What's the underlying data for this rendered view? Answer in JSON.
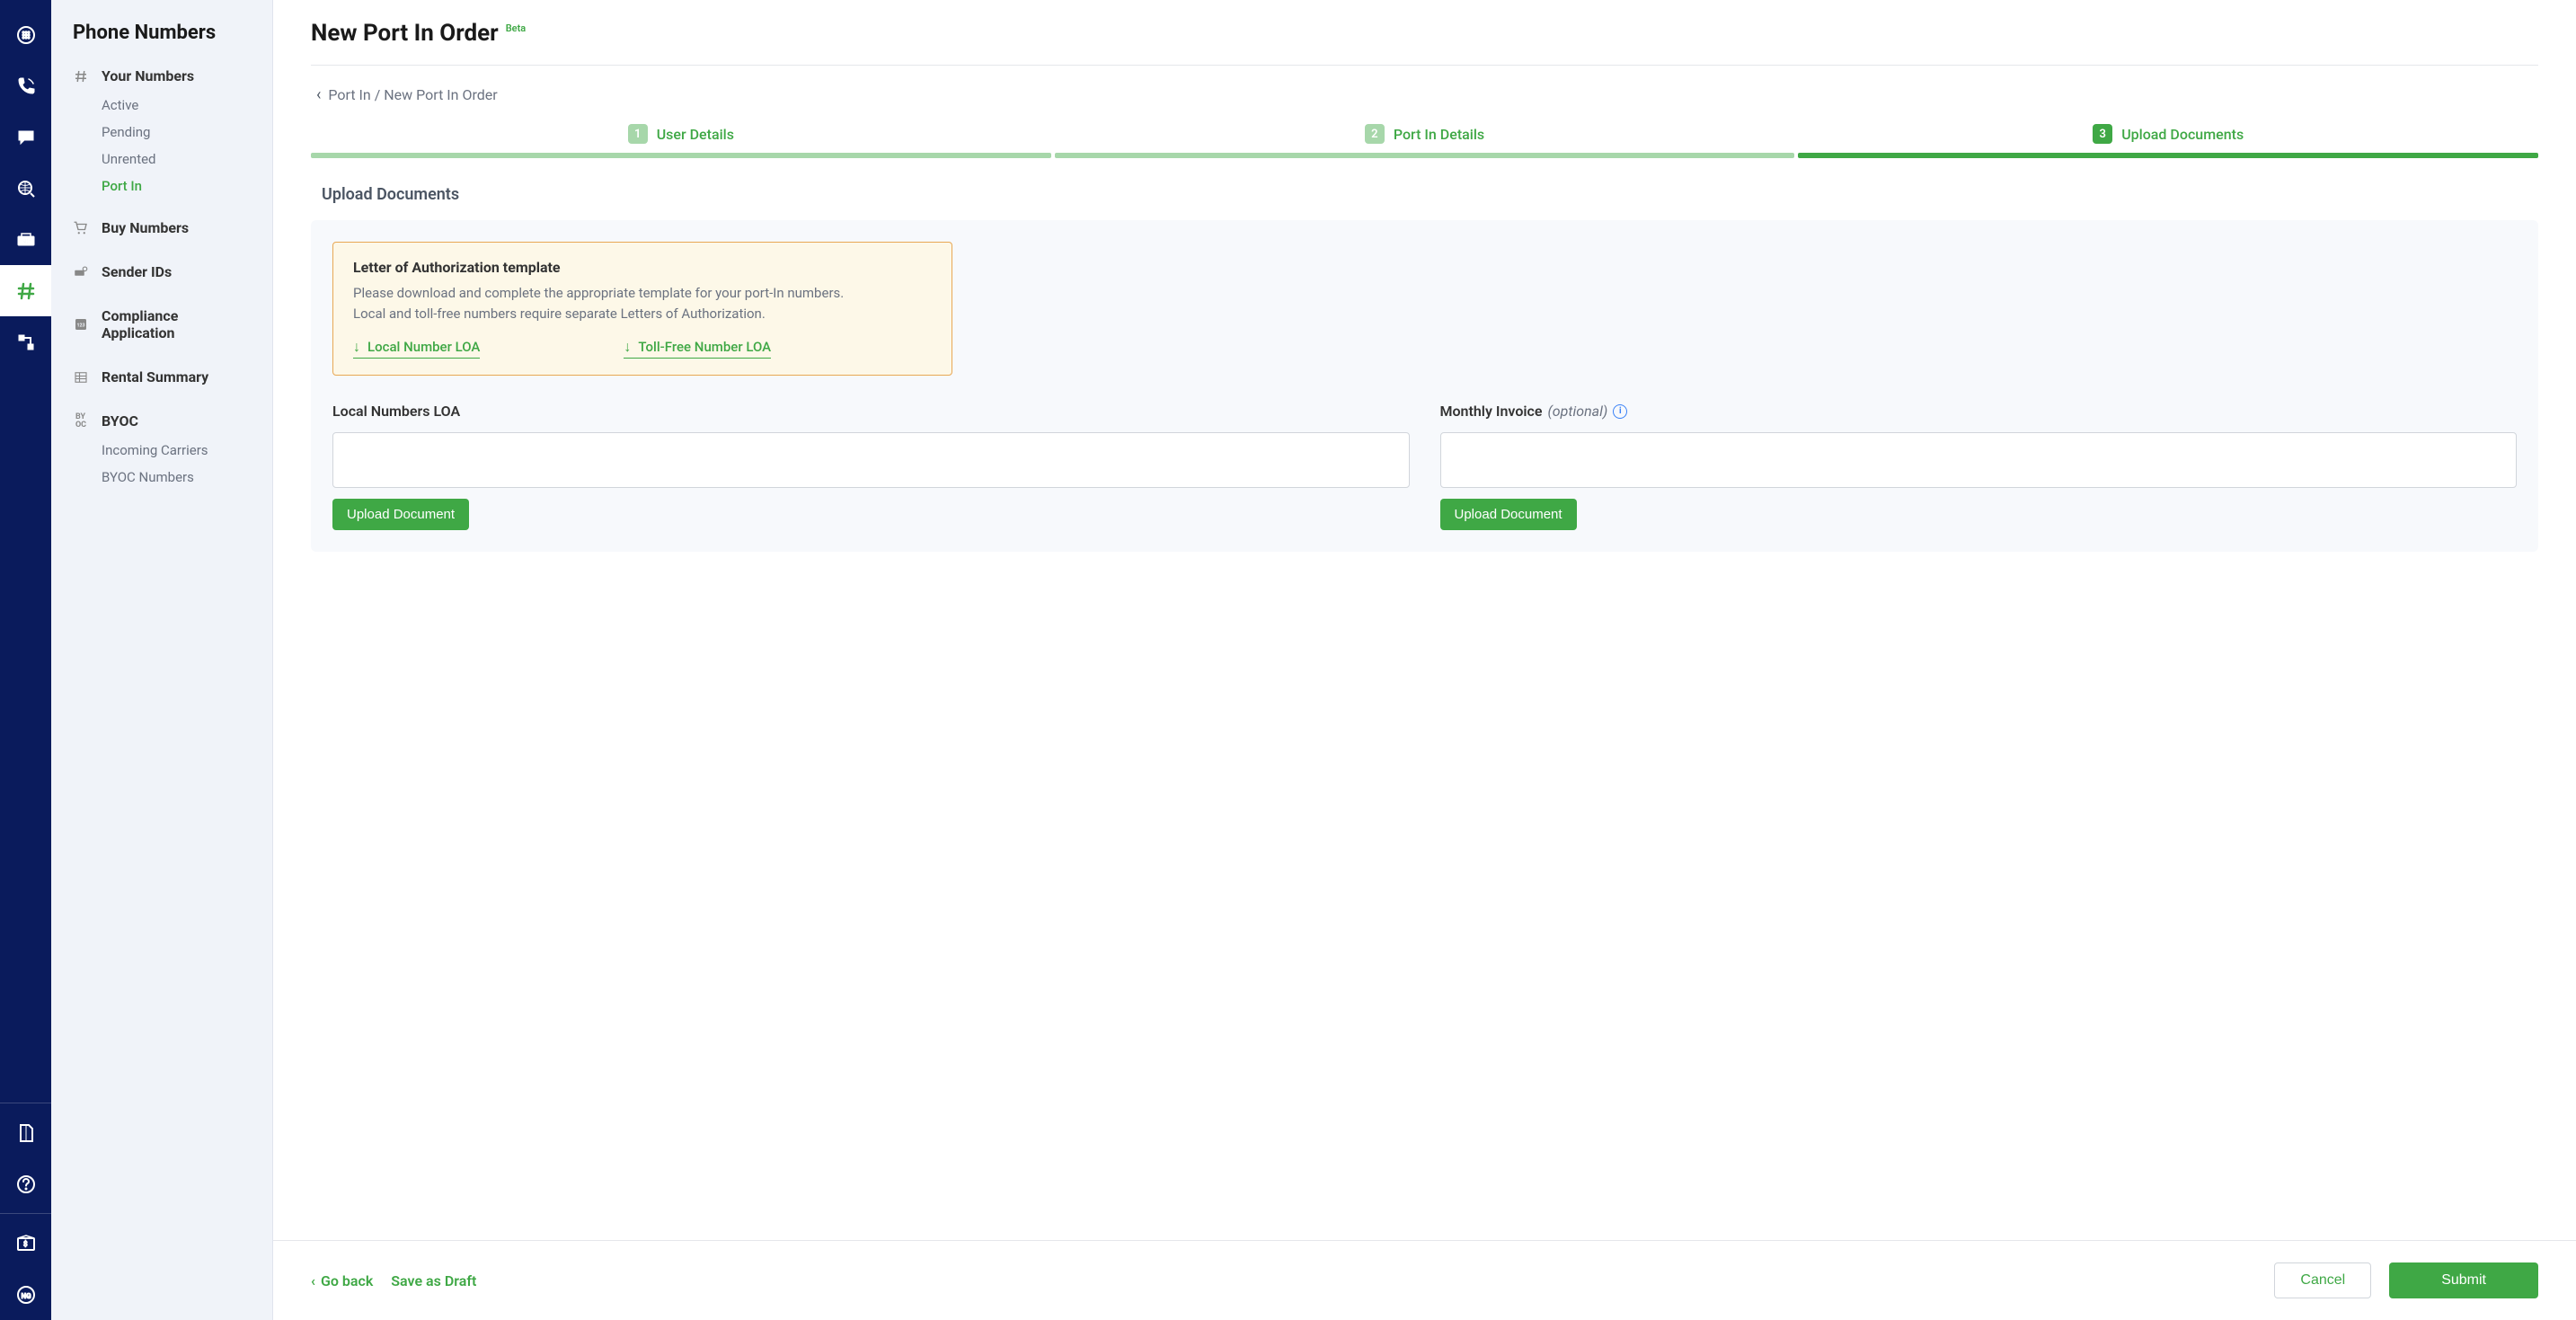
{
  "iconRail": {
    "items": [
      {
        "name": "cloud-dialpad-icon"
      },
      {
        "name": "phone-icon"
      },
      {
        "name": "chat-icon"
      },
      {
        "name": "globe-search-icon"
      },
      {
        "name": "sip-icon"
      },
      {
        "name": "hash-icon",
        "highlight": true
      },
      {
        "name": "network-icon"
      }
    ],
    "footerItems": [
      {
        "name": "docs-icon"
      },
      {
        "name": "help-icon"
      },
      {
        "name": "billing-icon"
      },
      {
        "name": "status-icon"
      }
    ]
  },
  "sidebar": {
    "title": "Phone Numbers",
    "groups": [
      {
        "label": "Your Numbers",
        "icon": "hash-icon",
        "items": [
          {
            "label": "Active"
          },
          {
            "label": "Pending"
          },
          {
            "label": "Unrented"
          },
          {
            "label": "Port In",
            "active": true
          }
        ]
      },
      {
        "label": "Buy Numbers",
        "icon": "cart-icon",
        "items": []
      },
      {
        "label": "Sender IDs",
        "icon": "sender-id-icon",
        "items": []
      },
      {
        "label": "Compliance Application",
        "icon": "compliance-icon",
        "items": []
      },
      {
        "label": "Rental Summary",
        "icon": "table-icon",
        "items": []
      },
      {
        "label": "BYOC",
        "icon": "byoc-icon",
        "items": [
          {
            "label": "Incoming Carriers"
          },
          {
            "label": "BYOC Numbers"
          }
        ]
      }
    ]
  },
  "main": {
    "title": "New Port In Order",
    "betaTag": "Beta",
    "breadcrumb": "Port In / New Port In Order",
    "steps": [
      {
        "num": "1",
        "label": "User Details",
        "muted": true
      },
      {
        "num": "2",
        "label": "Port In Details",
        "muted": true
      },
      {
        "num": "3",
        "label": "Upload Documents",
        "muted": false
      }
    ],
    "sectionTitle": "Upload Documents",
    "loaBox": {
      "title": "Letter of Authorization template",
      "line1": "Please download and complete the appropriate template for your port-In numbers.",
      "line2": "Local and toll-free numbers require separate Letters of Authorization.",
      "localLink": "Local Number LOA",
      "tollFreeLink": "Toll-Free Number LOA"
    },
    "uploads": {
      "local": {
        "label": "Local Numbers LOA",
        "button": "Upload Document"
      },
      "invoice": {
        "label": "Monthly Invoice",
        "optional": "(optional)",
        "button": "Upload Document"
      }
    }
  },
  "footer": {
    "goBack": "Go back",
    "saveDraft": "Save as Draft",
    "cancel": "Cancel",
    "submit": "Submit"
  }
}
